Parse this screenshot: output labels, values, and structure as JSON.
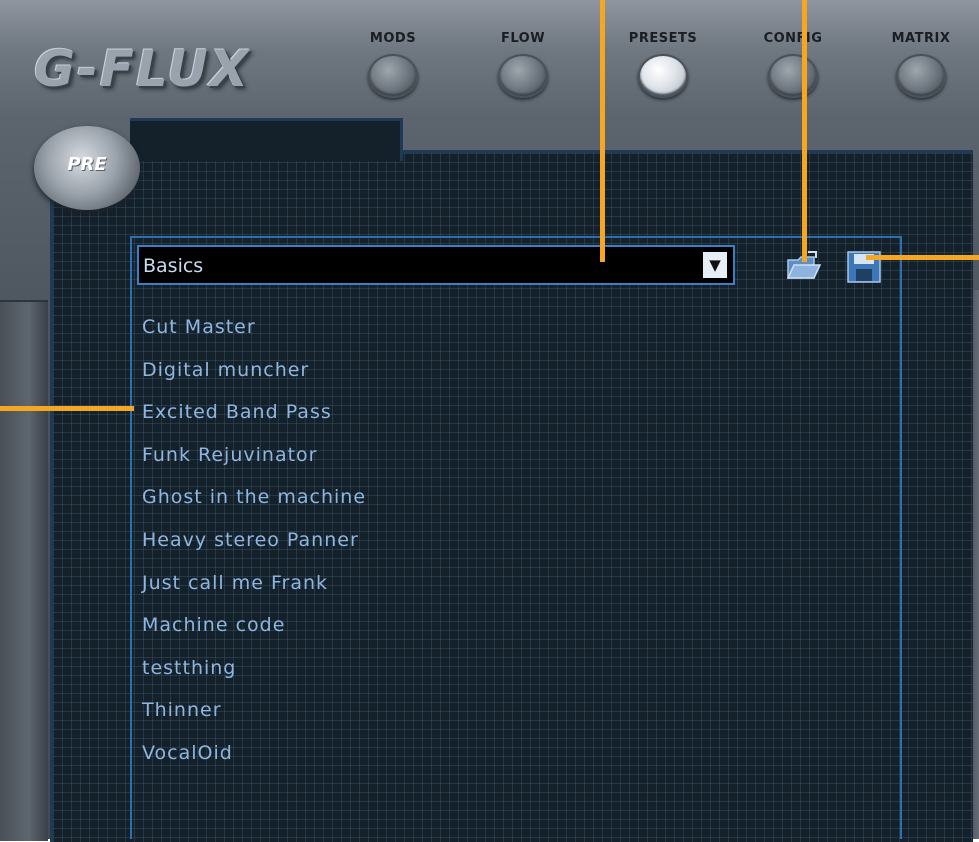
{
  "app": {
    "logo": "G-FLUX",
    "mode_badge": "PRE"
  },
  "nav": {
    "items": [
      {
        "label": "MODS",
        "active": false
      },
      {
        "label": "FLOW",
        "active": false
      },
      {
        "label": "PRESETS",
        "active": true
      },
      {
        "label": "CONFIG",
        "active": false
      },
      {
        "label": "MATRIX",
        "active": false
      }
    ]
  },
  "presets": {
    "bank_selected": "Basics",
    "dropdown_icon": "triangle-down",
    "open_icon": "folder-open-icon",
    "save_icon": "floppy-disk-icon",
    "items": [
      "Cut Master",
      "Digital muncher",
      "Excited Band Pass",
      "Funk Rejuvinator",
      "Ghost in the machine",
      "Heavy stereo Panner",
      "Just call me Frank",
      "Machine code",
      "testthing",
      "Thinner",
      "VocalOid"
    ]
  },
  "colors": {
    "accent_blue": "#3d7fc6",
    "list_text": "#8fb6e0",
    "callout": "#f5a623",
    "active_knob": "#dfe4ea"
  }
}
